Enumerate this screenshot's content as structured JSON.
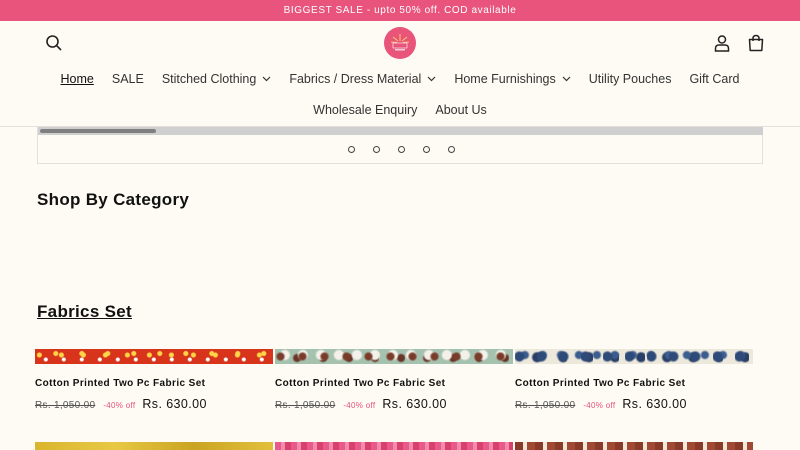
{
  "announcement": "BIGGEST SALE - upto 50% off. COD available",
  "nav": {
    "row1": [
      {
        "label": "Home",
        "dropdown": false,
        "active": true
      },
      {
        "label": "SALE",
        "dropdown": false
      },
      {
        "label": "Stitched Clothing",
        "dropdown": true
      },
      {
        "label": "Fabrics / Dress Material",
        "dropdown": true
      },
      {
        "label": "Home Furnishings",
        "dropdown": true
      },
      {
        "label": "Utility Pouches",
        "dropdown": false
      },
      {
        "label": "Gift Card",
        "dropdown": false
      }
    ],
    "row2": [
      {
        "label": "Wholesale Enquiry"
      },
      {
        "label": "About Us"
      }
    ]
  },
  "slider": {
    "dot_count": 5,
    "progress_fraction": 0.16
  },
  "sections": {
    "category_heading": "Shop By Category",
    "fabrics_heading": "Fabrics Set"
  },
  "products": [
    {
      "title": "Cotton Printed Two Pc Fabric Set",
      "old_price": "Rs. 1,050.00",
      "discount": "-40% off",
      "price": "Rs. 630.00",
      "pattern": "red-bandhani"
    },
    {
      "title": "Cotton Printed Two Pc Fabric Set",
      "old_price": "Rs. 1,050.00",
      "discount": "-40% off",
      "price": "Rs. 630.00",
      "pattern": "sage-floral"
    },
    {
      "title": "Cotton Printed Two Pc Fabric Set",
      "old_price": "Rs. 1,050.00",
      "discount": "-40% off",
      "price": "Rs. 630.00",
      "pattern": "indigo-floral"
    }
  ],
  "colors": {
    "accent": "#e8547c",
    "background": "#fdfbf3"
  }
}
